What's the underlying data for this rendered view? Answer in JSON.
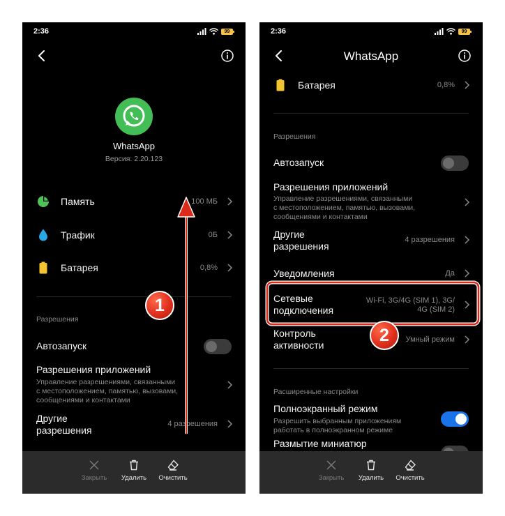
{
  "colors": {
    "accent": "#1a73e8",
    "whatsapp_green": "#43bd56",
    "annotation_red": "#e0301e"
  },
  "left": {
    "time": "2:36",
    "battery_level": "99",
    "app": {
      "name": "WhatsApp",
      "version": "Версия: 2.20.123"
    },
    "items": [
      {
        "icon": "pie-chart-icon",
        "label": "Память",
        "value": "100 МБ"
      },
      {
        "icon": "water-drop-icon",
        "label": "Трафик",
        "value": "0Б"
      },
      {
        "icon": "battery-icon",
        "label": "Батарея",
        "value": "0,8%"
      }
    ],
    "permissions_section": "Разрешения",
    "autostart": {
      "label": "Автозапуск",
      "enabled": false
    },
    "app_permissions": {
      "label": "Разрешения приложений",
      "sub": [
        "Управление разрешениями, связанными",
        "с местоположением, памятью, вызовами,",
        "сообщениями и контактами"
      ]
    },
    "other_permissions": {
      "label": [
        "Другие",
        "разрешения"
      ],
      "value": "4 разрешения"
    },
    "badge": "1"
  },
  "right": {
    "time": "2:36",
    "battery_level": "99",
    "title": "WhatsApp",
    "battery_item": {
      "label": "Батарея",
      "value": "0,8%"
    },
    "permissions_section": "Разрешения",
    "autostart": {
      "label": "Автозапуск",
      "enabled": false
    },
    "app_permissions": {
      "label": "Разрешения приложений",
      "sub": [
        "Управление разрешениями, связанными",
        "с местоположением, памятью, вызовами,",
        "сообщениями и контактами"
      ]
    },
    "other_permissions": {
      "label": [
        "Другие",
        "разрешения"
      ],
      "value": "4 разрешения"
    },
    "notifications": {
      "label": "Уведомления",
      "value": "Да"
    },
    "network": {
      "label": [
        "Сетевые",
        "подключения"
      ],
      "value": [
        "Wi-Fi, 3G/4G (SIM 1), 3G/",
        "4G (SIM 2)"
      ]
    },
    "activity": {
      "label": [
        "Контроль",
        "активности"
      ],
      "value": "Умный режим"
    },
    "advanced_section": "Расширенные настройки",
    "fullscreen": {
      "label": "Полноэкранный режим",
      "sub": [
        "Разрешить выбранным приложениям",
        "работать в полноэкранном режиме"
      ],
      "enabled": true
    },
    "blur": {
      "label": "Размытие миниатюр"
    },
    "badge": "2"
  },
  "bottom": {
    "close": "Закрыть",
    "delete": "Удалить",
    "clear": "Очистить"
  }
}
